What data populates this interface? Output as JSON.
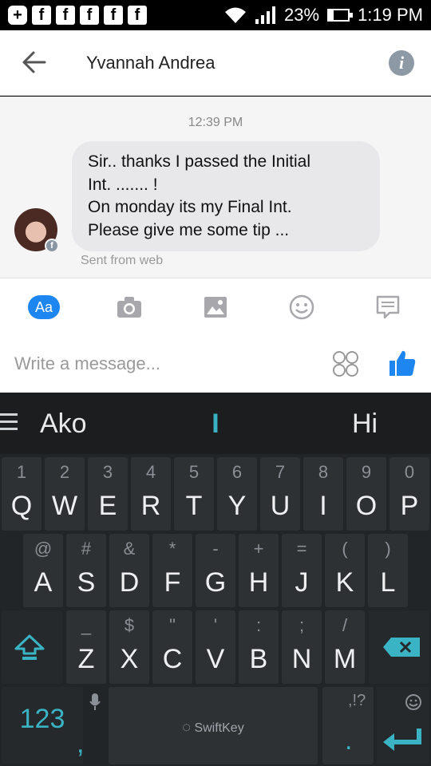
{
  "status_bar": {
    "notification_icons": [
      "plus-icon",
      "facebook-icon",
      "facebook-icon",
      "facebook-icon",
      "facebook-icon",
      "facebook-icon"
    ],
    "battery": "23%",
    "battery_level": 0.23,
    "time": "1:19 PM"
  },
  "header": {
    "contact_name": "Yvannah Andrea"
  },
  "conversation": {
    "timestamp": "12:39 PM",
    "message_lines": [
      "Sir.. thanks I passed the Initial",
      "Int. ....... !",
      "On monday its my Final Int.",
      "Please give me some tip ..."
    ],
    "sent_from": "Sent from web"
  },
  "composer": {
    "aa_label": "Aa",
    "placeholder": "Write a message..."
  },
  "keyboard": {
    "suggestions": [
      "Ako",
      "I",
      "Hi"
    ],
    "row1": [
      {
        "main": "Q",
        "alt": "1"
      },
      {
        "main": "W",
        "alt": "2"
      },
      {
        "main": "E",
        "alt": "3"
      },
      {
        "main": "R",
        "alt": "4"
      },
      {
        "main": "T",
        "alt": "5"
      },
      {
        "main": "Y",
        "alt": "6"
      },
      {
        "main": "U",
        "alt": "7"
      },
      {
        "main": "I",
        "alt": "8"
      },
      {
        "main": "O",
        "alt": "9"
      },
      {
        "main": "P",
        "alt": "0"
      }
    ],
    "row2": [
      {
        "main": "A",
        "alt": "@"
      },
      {
        "main": "S",
        "alt": "#"
      },
      {
        "main": "D",
        "alt": "&"
      },
      {
        "main": "F",
        "alt": "*"
      },
      {
        "main": "G",
        "alt": "-"
      },
      {
        "main": "H",
        "alt": "+"
      },
      {
        "main": "J",
        "alt": "="
      },
      {
        "main": "K",
        "alt": "("
      },
      {
        "main": "L",
        "alt": ")"
      }
    ],
    "row3": [
      {
        "main": "Z",
        "alt": "_"
      },
      {
        "main": "X",
        "alt": "$"
      },
      {
        "main": "C",
        "alt": "\""
      },
      {
        "main": "V",
        "alt": "'"
      },
      {
        "main": "B",
        "alt": ":"
      },
      {
        "main": "N",
        "alt": ";"
      },
      {
        "main": "M",
        "alt": "/"
      }
    ],
    "numbers_key": "123",
    "comma_key": ",",
    "space_brand": "SwiftKey",
    "period_key": ".",
    "punct_hint": ",!?",
    "accent_color": "#3ab4c4"
  }
}
